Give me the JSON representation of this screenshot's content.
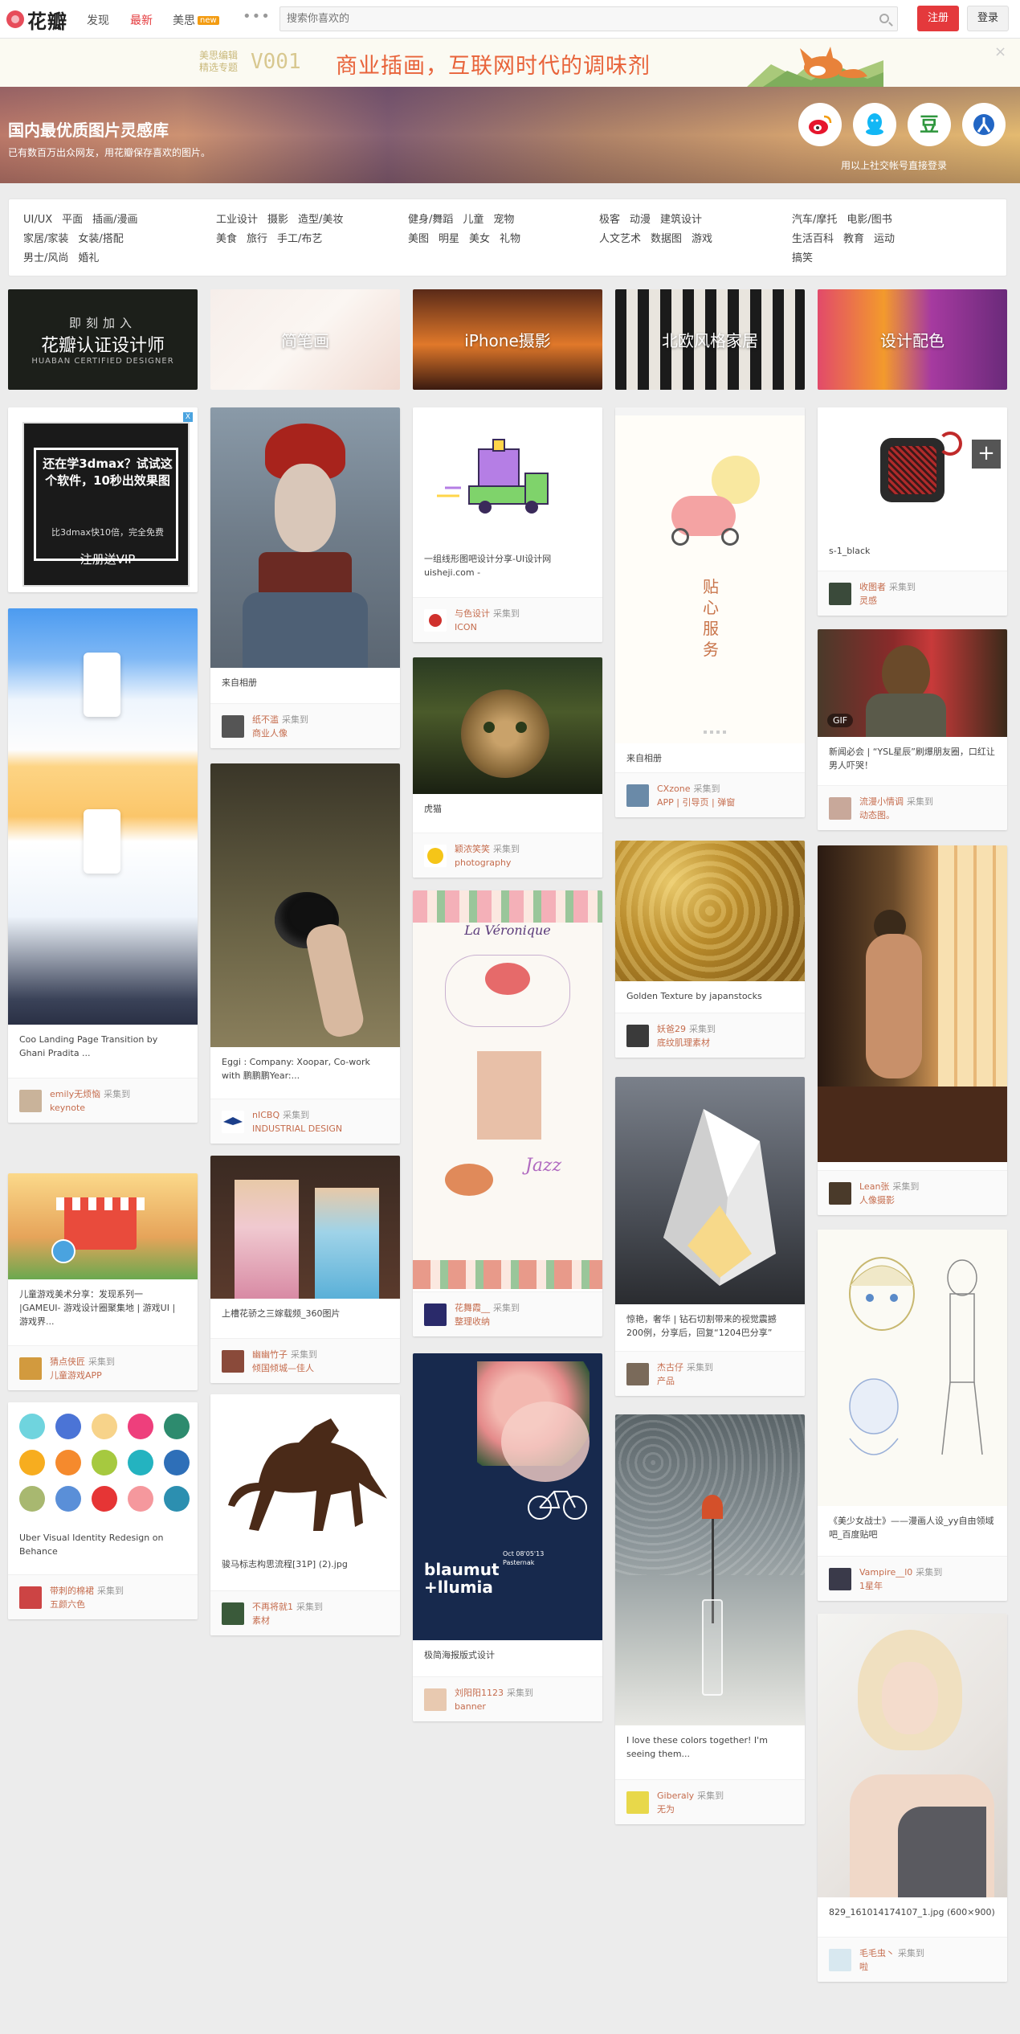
{
  "header": {
    "logo_text": "花瓣",
    "nav": {
      "discover": "发现",
      "latest": "最新",
      "meisi": "美思",
      "new_badge": "new",
      "more": "•••"
    },
    "search_placeholder": "搜索你喜欢的",
    "signup": "注册",
    "login": "登录"
  },
  "promo": {
    "small_line1": "美思编辑",
    "small_line2": "精选专题",
    "code": "V001",
    "title": "商业插画，互联网时代的调味剂",
    "close": "×"
  },
  "banner": {
    "title": "国内最优质图片灵感库",
    "subtitle": "已有数百万出众网友，用花瓣保存喜欢的图片。",
    "social_hint": "用以上社交帐号直接登录",
    "social_icons": [
      "weibo-icon",
      "qq-icon",
      "douban-icon",
      "renren-icon"
    ],
    "douban_glyph": "豆"
  },
  "categories": {
    "group1": [
      "UI/UX",
      "平面",
      "插画/漫画",
      "家居/家装",
      "女装/搭配",
      "男士/风尚",
      "婚礼"
    ],
    "group2": [
      "工业设计",
      "摄影",
      "造型/美妆",
      "美食",
      "旅行",
      "手工/布艺"
    ],
    "group3": [
      "健身/舞蹈",
      "儿童",
      "宠物",
      "美图",
      "明星",
      "美女",
      "礼物"
    ],
    "group4": [
      "极客",
      "动漫",
      "建筑设计",
      "人文艺术",
      "数据图",
      "游戏"
    ],
    "group5": [
      "汽车/摩托",
      "电影/图书",
      "生活百科",
      "教育",
      "运动",
      "搞笑"
    ]
  },
  "category_tiles": [
    {
      "label": "花瓣认证设计师",
      "sub": "即刻加入",
      "en": "HUABAN CERTIFIED DESIGNER"
    },
    {
      "label": "简笔画"
    },
    {
      "label": "iPhone摄影"
    },
    {
      "label": "北欧风格家居"
    },
    {
      "label": "设计配色"
    }
  ],
  "ad": {
    "title": "还在学3dmax？试试这个软件，10秒出效果图",
    "sub": "比3dmax快10倍，完全免费",
    "cta": "注册送VIP",
    "close": "X"
  },
  "pins": {
    "p_coo": {
      "desc": "Coo Landing Page Transition by Ghani Pradita ...",
      "user": "emily无烦恼",
      "action": "采集到",
      "board": "keynote"
    },
    "p_game": {
      "desc": "儿童游戏美术分享：发现系列一 |GAMEUI- 游戏设计圈聚集地 | 游戏UI | 游戏界...",
      "user": "猜点侠匠",
      "action": "采集到",
      "board": "儿童游戏APP"
    },
    "p_uber": {
      "desc": "Uber Visual Identity Redesign on Behance",
      "user": "带刺的棉裙",
      "action": "采集到",
      "board": "五颜六色"
    },
    "p_red": {
      "desc": "来自相册",
      "user": "纸不滥",
      "action": "采集到",
      "board": "商业人像"
    },
    "p_cup": {
      "desc": "Eggi : Company: Xoopar, Co-work with 鹏鹏鹏Year:...",
      "user": "nICBQ",
      "action": "采集到",
      "board": "INDUSTRIAL DESIGN"
    },
    "p_palace": {
      "desc": "上槽花骄之三嫁载频_360图片",
      "user": "幽幽竹子",
      "action": "采集到",
      "board": "倾国倾城—佳人"
    },
    "p_horse": {
      "desc": "骏马标志构思流程[31P] (2).jpg",
      "user": "不再将就1",
      "action": "采集到",
      "board": "素材"
    },
    "p_truck": {
      "desc": "一组线形图吧设计分享-UI设计网 uisheji.com -",
      "user": "与色设计",
      "action": "采集到",
      "board": "ICON"
    },
    "p_cat": {
      "desc": "虎猫",
      "user": "颖浓笑笑",
      "action": "采集到",
      "board": "photography"
    },
    "p_veronique": {
      "desc": "",
      "user": "花舞霞__",
      "action": "采集到",
      "board": "整理收纳"
    },
    "p_blaumut": {
      "desc": "极简海报版式设计",
      "user": "刘阳阳1123",
      "action": "采集到",
      "board": "banner"
    },
    "p_app": {
      "desc": "来自相册",
      "user": "CXzone",
      "action": "采集到",
      "board": "APP | 引导页 | 弹窗"
    },
    "p_gold": {
      "desc": "Golden Texture by japanstocks",
      "user": "妖爸29",
      "action": "采集到",
      "board": "底纹肌理素材"
    },
    "p_lamp": {
      "desc": "惊艳，奢华 | 钻石切割带来的视觉震撼 200例，分享后，回复“1204巴分享”",
      "user": "杰古仔",
      "action": "采集到",
      "board": "产品"
    },
    "p_vase": {
      "desc": "I love these colors together! I'm seeing them...",
      "user": "Giberaly",
      "action": "采集到",
      "board": "无为"
    },
    "p_speaker": {
      "desc": "s-1_black",
      "user": "收图者",
      "action": "采集到",
      "board": "灵感"
    },
    "p_gif": {
      "desc": "新闻必会 | “YSL星辰”刷爆朋友圈，口红让男人吓哭！",
      "user": "流漫小情调",
      "action": "采集到",
      "board": "动态图。",
      "badge": "GIF"
    },
    "p_window": {
      "desc": "",
      "user": "Lean张",
      "action": "采集到",
      "board": "人像摄影"
    },
    "p_anime": {
      "desc": "《美少女战士》——漫画人设_yy自由领域吧_百度贴吧",
      "user": "Vampire__l0",
      "action": "采集到",
      "board": "1星年"
    },
    "p_blonde": {
      "desc": "829_161014174107_1.jpg (600×900)",
      "user": "毛毛虫丶",
      "action": "采集到",
      "board": "啦"
    }
  },
  "poster_text": {
    "app_big": "贴心服务",
    "veronique": "La Véronique",
    "jazz": "Jazz",
    "blaumut": "blaumut +llumia",
    "pasternak": "Oct 08'05'13 Pasternak"
  },
  "colors": {
    "accent": "#e4393c",
    "promo": "#e8633a",
    "meta": "#c56c4d"
  },
  "uber_colors": [
    "#6fd4de",
    "#4b74d6",
    "#f7d38a",
    "#ee3f7c",
    "#2d8b6e",
    "#f7ad1f",
    "#f58a2d",
    "#a6c93f",
    "#24b3c0",
    "#2e6fb8",
    "#a8b870",
    "#5a8fd8",
    "#e63535",
    "#f5989d",
    "#2c8fb0"
  ]
}
